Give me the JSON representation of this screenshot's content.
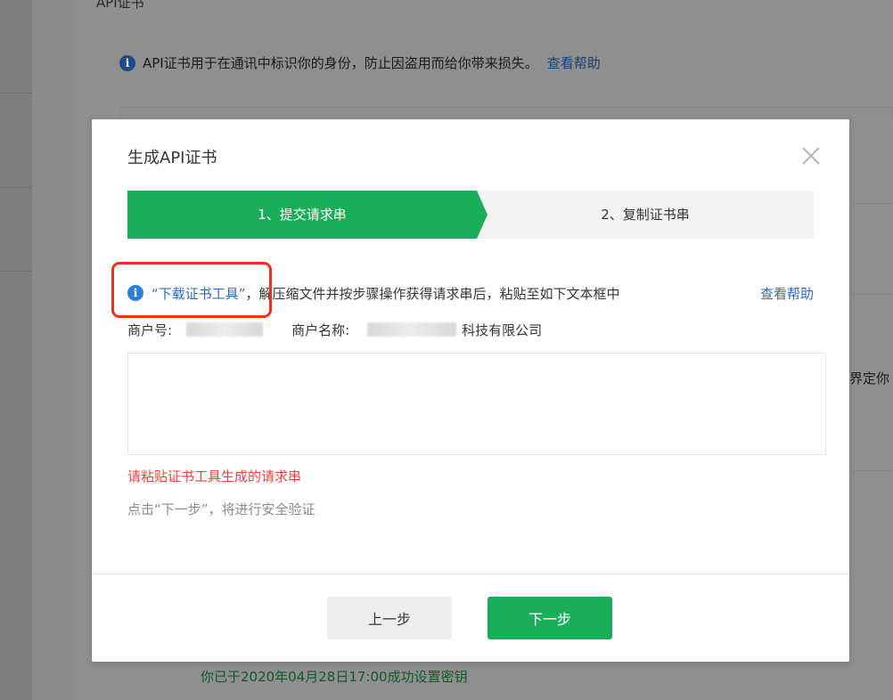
{
  "background": {
    "section_title": "API证书",
    "info_text": "API证书用于在通讯中标识你的身份，防止因盗用而给你带来损失。",
    "info_help": "查看帮助",
    "side_text": "界定你",
    "success_text": "你已于2020年04月28日17:00成功设置密钥"
  },
  "modal": {
    "title": "生成API证书",
    "steps": [
      {
        "label": "1、提交请求串",
        "active": true
      },
      {
        "label": "2、复制证书串",
        "active": false
      }
    ],
    "notice": {
      "download_link": "“下载证书工具”",
      "description": "，解压缩文件并按步骤操作获得请求串后，粘贴至如下文本框中",
      "help_link": "查看帮助"
    },
    "merchant": {
      "id_label": "商户号:",
      "name_label": "商户名称:",
      "name_suffix": "科技有限公司"
    },
    "textarea": {
      "value": "",
      "placeholder": ""
    },
    "error_text": "请粘贴证书工具生成的请求串",
    "hint_text": "点击“下一步”，将进行安全验证",
    "buttons": {
      "prev": "上一步",
      "next": "下一步"
    }
  },
  "colors": {
    "accent_green": "#1aad5a",
    "link_blue": "#2d6bb5",
    "error_red": "#e8443a",
    "highlight_red": "#e8311f"
  }
}
